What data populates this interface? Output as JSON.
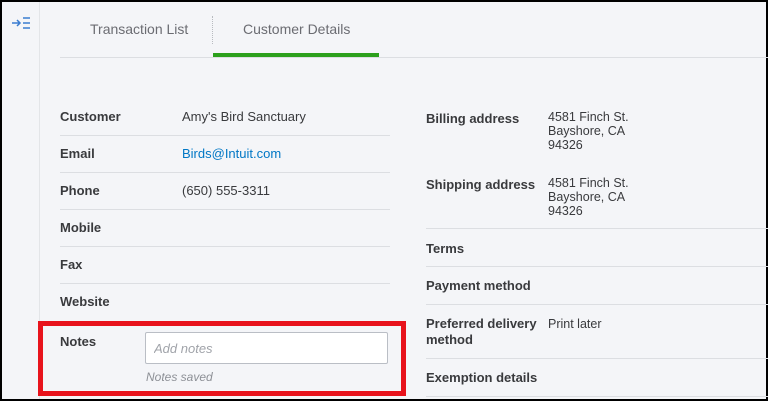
{
  "sidebar": {
    "toggle_icon": "collapse-panel-icon"
  },
  "tabs": [
    {
      "label": "Transaction List",
      "active": false
    },
    {
      "label": "Customer Details",
      "active": true
    }
  ],
  "accent_color": "#2ca01c",
  "highlight_color": "#e8131c",
  "left_fields": [
    {
      "label": "Customer",
      "value": "Amy's Bird Sanctuary"
    },
    {
      "label": "Email",
      "value": "Birds@Intuit.com"
    },
    {
      "label": "Phone",
      "value": "(650) 555-3311"
    },
    {
      "label": "Mobile",
      "value": ""
    },
    {
      "label": "Fax",
      "value": ""
    },
    {
      "label": "Website",
      "value": ""
    }
  ],
  "notes": {
    "label": "Notes",
    "placeholder": "Add notes",
    "status": "Notes saved"
  },
  "right_fields": {
    "billing": {
      "label": "Billing address",
      "line1": "4581 Finch St.",
      "line2": "Bayshore, CA",
      "line3": "94326"
    },
    "shipping": {
      "label": "Shipping address",
      "line1": "4581 Finch St.",
      "line2": "Bayshore, CA",
      "line3": "94326"
    },
    "terms": {
      "label": "Terms",
      "value": ""
    },
    "payment_method": {
      "label": "Payment method",
      "value": ""
    },
    "preferred_delivery": {
      "label_line1": "Preferred delivery",
      "label_line2": "method",
      "value": "Print later"
    },
    "exemption": {
      "label": "Exemption details",
      "value": ""
    }
  }
}
